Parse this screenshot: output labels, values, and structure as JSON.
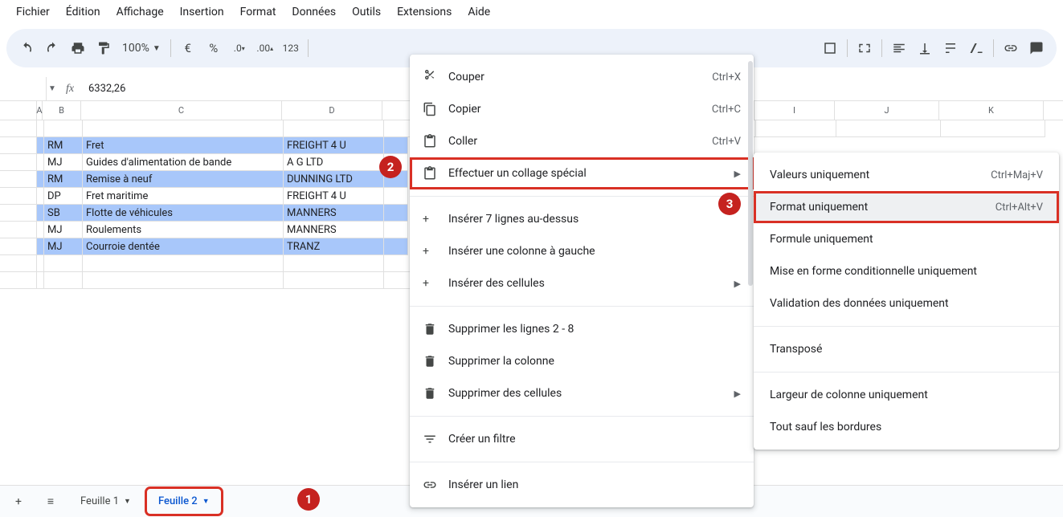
{
  "menubar": [
    "Fichier",
    "Édition",
    "Affichage",
    "Insertion",
    "Format",
    "Données",
    "Outils",
    "Extensions",
    "Aide"
  ],
  "toolbar": {
    "zoom": "100%",
    "currency": "€",
    "percent": "%",
    "dec_dec": ",0←",
    "dec_inc": ",00→",
    "num_fmt": "123"
  },
  "formula_bar": {
    "value": "6332,26"
  },
  "col_headers": [
    "A",
    "B",
    "C",
    "D",
    "",
    "",
    "",
    "",
    "I",
    "J",
    "K"
  ],
  "data": [
    {
      "b": "RM",
      "c": "Fret",
      "d": "FREIGHT 4 U",
      "sel": true
    },
    {
      "b": "MJ",
      "c": "Guides d'alimentation de bande",
      "d": "A G LTD",
      "sel": false
    },
    {
      "b": "RM",
      "c": "Remise à neuf",
      "d": "DUNNING LTD",
      "sel": true
    },
    {
      "b": "DP",
      "c": "Fret maritime",
      "d": "FREIGHT 4 U",
      "sel": false
    },
    {
      "b": "SB",
      "c": "Flotte de véhicules",
      "d": "MANNERS",
      "sel": true
    },
    {
      "b": "MJ",
      "c": "Roulements",
      "d": "MANNERS",
      "sel": false
    },
    {
      "b": "MJ",
      "c": "Courroie dentée",
      "d": "TRANZ",
      "sel": true
    }
  ],
  "context_menu": {
    "cut": {
      "label": "Couper",
      "shortcut": "Ctrl+X"
    },
    "copy": {
      "label": "Copier",
      "shortcut": "Ctrl+C"
    },
    "paste": {
      "label": "Coller",
      "shortcut": "Ctrl+V"
    },
    "paste_special": {
      "label": "Effectuer un collage spécial"
    },
    "insert_rows": {
      "label": "Insérer 7 lignes au-dessus"
    },
    "insert_col": {
      "label": "Insérer une colonne à gauche"
    },
    "insert_cells": {
      "label": "Insérer des cellules"
    },
    "delete_rows": {
      "label": "Supprimer les lignes 2 - 8"
    },
    "delete_col": {
      "label": "Supprimer la colonne"
    },
    "delete_cells": {
      "label": "Supprimer des cellules"
    },
    "filter": {
      "label": "Créer un filtre"
    },
    "link": {
      "label": "Insérer un lien"
    }
  },
  "submenu": {
    "values": {
      "label": "Valeurs uniquement",
      "shortcut": "Ctrl+Maj+V"
    },
    "format": {
      "label": "Format uniquement",
      "shortcut": "Ctrl+Alt+V"
    },
    "formula": {
      "label": "Formule uniquement"
    },
    "cond": {
      "label": "Mise en forme conditionnelle uniquement"
    },
    "validation": {
      "label": "Validation des données uniquement"
    },
    "transpose": {
      "label": "Transposé"
    },
    "colwidth": {
      "label": "Largeur de colonne uniquement"
    },
    "noborders": {
      "label": "Tout sauf les bordures"
    }
  },
  "tabs": {
    "t1": "Feuille 1",
    "t2": "Feuille 2"
  },
  "badges": {
    "b1": "1",
    "b2": "2",
    "b3": "3"
  }
}
